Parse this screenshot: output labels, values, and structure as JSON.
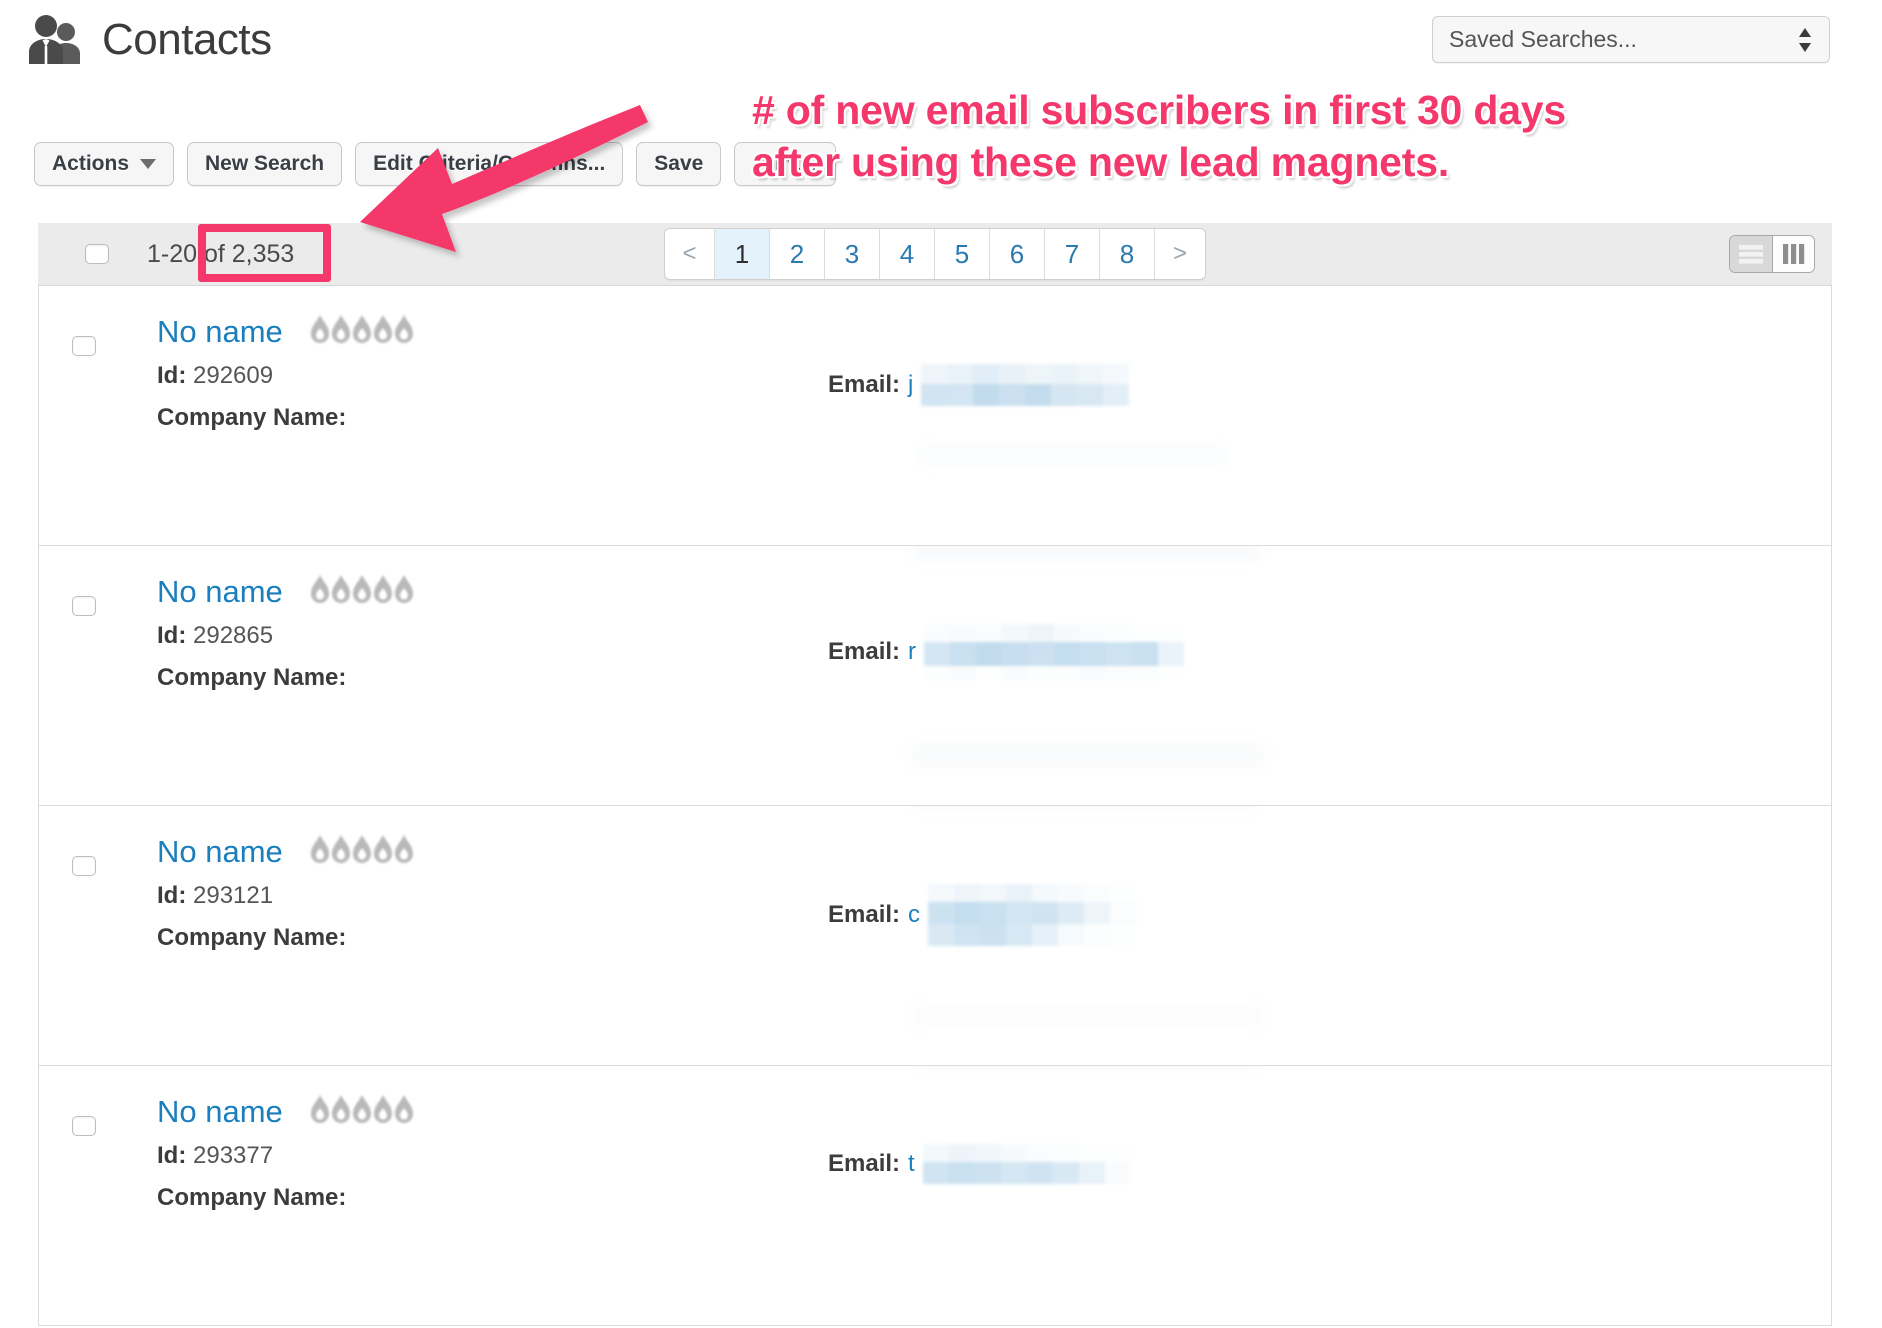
{
  "header": {
    "title": "Contacts",
    "icon": "contacts-people-icon"
  },
  "saved_search": {
    "value": "Saved Searches...",
    "icon": "select-stepper-arrows-icon"
  },
  "toolbar": {
    "actions_label": "Actions",
    "new_search_label": "New Search",
    "edit_criteria_label": "Edit Criteria/Columns...",
    "save_label": "Save",
    "print_label": "Print..."
  },
  "results_bar": {
    "count_text": "1-20 of 2,353",
    "range": "1-20",
    "total": "2,353"
  },
  "pagination": {
    "prev": "<",
    "next": ">",
    "pages": [
      "1",
      "2",
      "3",
      "4",
      "5",
      "6",
      "7",
      "8"
    ],
    "active": "1"
  },
  "view_toggle": {
    "list_view": "list-view-icon",
    "column_view": "column-view-icon",
    "active": "column_view"
  },
  "labels": {
    "id": "Id:",
    "company": "Company Name:",
    "email": "Email:"
  },
  "contacts": [
    {
      "name": "No name",
      "id": "292609",
      "company": "",
      "email_first_char": "j",
      "flames": 5
    },
    {
      "name": "No name",
      "id": "292865",
      "company": "",
      "email_first_char": "r",
      "flames": 5
    },
    {
      "name": "No name",
      "id": "293121",
      "company": "",
      "email_first_char": "c",
      "flames": 5
    },
    {
      "name": "No name",
      "id": "293377",
      "company": "",
      "email_first_char": "t",
      "flames": 5
    }
  ],
  "annotations": {
    "callout_line1": "# of new email subscribers in first 30 days",
    "callout_line2": "after using these new lead magnets.",
    "callout_text": "# of new email subscribers in first 30 days after using these new lead magnets.",
    "arrow": "curved-arrow-pointing-to-total",
    "highlight_box": "total-count-highlight"
  },
  "colors": {
    "annotation_pink": "#f4386b",
    "link_blue": "#1b7fbd",
    "active_page_bg": "#e4f3fb",
    "panel_header_bg": "#ebebeb",
    "redaction_blue": "#c7dff0"
  }
}
